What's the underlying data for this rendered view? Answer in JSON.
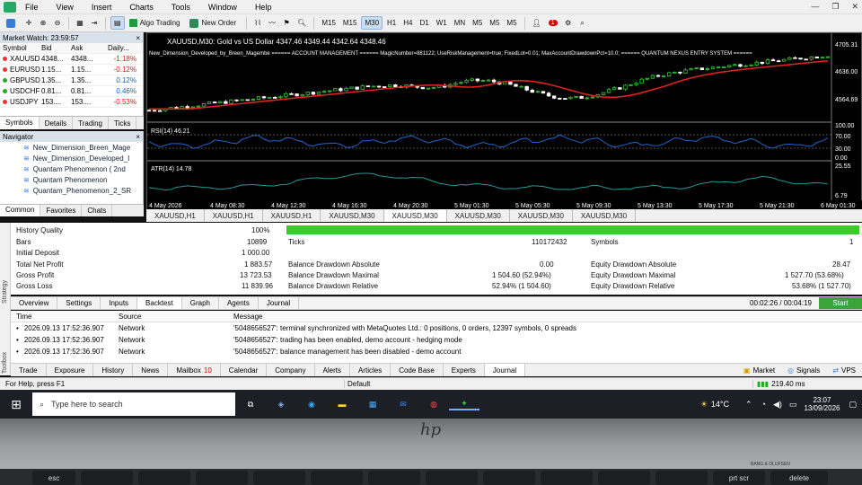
{
  "menu": {
    "items": [
      "File",
      "View",
      "Insert",
      "Charts",
      "Tools",
      "Window",
      "Help"
    ]
  },
  "toolbar": {
    "algo_trading": "Algo Trading",
    "new_order": "New Order",
    "timeframes": [
      "M1",
      "M5",
      "M15",
      "M30",
      "H1",
      "H4",
      "D1",
      "W1",
      "MN"
    ],
    "active_tf": "M30",
    "second_tf": [
      "M5",
      "M5",
      "M5"
    ],
    "notification_count": "1"
  },
  "market_watch": {
    "title": "Market Watch: 23:59:57",
    "headers": [
      "Symbol",
      "Bid",
      "Ask",
      "Daily..."
    ],
    "rows": [
      {
        "symbol": "XAUUSD",
        "bid": "4348...",
        "ask": "4348...",
        "change": "-1.18%",
        "dir": "neg"
      },
      {
        "symbol": "EURUSD",
        "bid": "1.15...",
        "ask": "1.15...",
        "change": "-0.12%",
        "dir": "neg"
      },
      {
        "symbol": "GBPUSD",
        "bid": "1.35...",
        "ask": "1.35...",
        "change": "0.12%",
        "dir": "pos"
      },
      {
        "symbol": "USDCHF",
        "bid": "0.81...",
        "ask": "0.81...",
        "change": "0.46%",
        "dir": "pos"
      },
      {
        "symbol": "USDJPY",
        "bid": "153....",
        "ask": "153....",
        "change": "-0.53%",
        "dir": "neg"
      }
    ],
    "tabs": [
      "Symbols",
      "Details",
      "Trading",
      "Ticks"
    ]
  },
  "navigator": {
    "title": "Navigator",
    "items": [
      "New_Dimension_Breen_Mage",
      "New_Dimension_Developed_I",
      "Quantam Phenomenon ( 2nd",
      "Quantam Phenomenon",
      "Quantam_Phenomenon_2_SR"
    ],
    "tabs": [
      "Common",
      "Favorites",
      "Chats"
    ]
  },
  "chart": {
    "title": "XAUUSD,M30:  Gold vs US Dollar  4347.46 4349.44 4342.64 4348.46",
    "ea_text": "New_Dimension_Developed_by_Breen_Magembe ====== ACCOUNT MANAGEMENT ====== MagicNumber=881122; UseRiskManagement=true; FixedLot=0.01; MaxAccountDrawdownPct=10.0; ====== QUANTUM NEXUS ENTRY SYSTEM ======",
    "price_labels": [
      "4705.31",
      "4636.00",
      "4564.69"
    ],
    "rsi_label": "RSI(14) 46.21",
    "rsi_levels": [
      "100.00",
      "70.00",
      "30.00",
      "0.00"
    ],
    "atr_label": "ATR(14) 14.78",
    "atr_levels": [
      "25.55",
      "6.79"
    ],
    "time_labels": [
      "4 May 2026",
      "4 May 08:30",
      "4 May 12:30",
      "4 May 16:30",
      "4 May 20:30",
      "5 May 01:30",
      "5 May 05:30",
      "5 May 09:30",
      "5 May 13:30",
      "5 May 17:30",
      "5 May 21:30",
      "6 May 01:30"
    ],
    "tabs": [
      "XAUUSD,H1",
      "XAUUSD,H1",
      "XAUUSD,H1",
      "XAUUSD,M30",
      "XAUUSD,M30",
      "XAUUSD,M30",
      "XAUUSD,M30",
      "XAUUSD,M30"
    ],
    "colors": {
      "bull": "#33cc33",
      "bear": "#ffffff",
      "ma_fast": "#dd2222",
      "indicator": "#2266cc",
      "atr": "#229999"
    }
  },
  "tester": {
    "history_quality_label": "History Quality",
    "history_quality": "100%",
    "quality_fill": 1.0,
    "bars_label": "Bars",
    "bars": "10899",
    "ticks_label": "Ticks",
    "ticks": "110172432",
    "symbols_label": "Symbols",
    "symbols": "1",
    "initial_deposit_label": "Initial Deposit",
    "initial_deposit": "1 000.00",
    "net_profit_label": "Total Net Profit",
    "net_profit": "1 883.57",
    "bal_dd_abs_label": "Balance Drawdown Absolute",
    "bal_dd_abs": "0.00",
    "eq_dd_abs_label": "Equity Drawdown Absolute",
    "eq_dd_abs": "28.47",
    "gross_profit_label": "Gross Profit",
    "gross_profit": "13 723.53",
    "bal_dd_max_label": "Balance Drawdown Maximal",
    "bal_dd_max": "1 504.60 (52.94%)",
    "eq_dd_max_label": "Equity Drawdown Maximal",
    "eq_dd_max": "1 527.70 (53.68%)",
    "gross_loss_label": "Gross Loss",
    "gross_loss": "11 839.96",
    "bal_dd_rel_label": "Balance Drawdown Relative",
    "bal_dd_rel": "52.94% (1 504.60)",
    "eq_dd_rel_label": "Equity Drawdown Relative",
    "eq_dd_rel": "53.68% (1 527.70)",
    "tabs": [
      "Overview",
      "Settings",
      "Inputs",
      "Backtest",
      "Graph",
      "Agents",
      "Journal"
    ],
    "active_tab": "Backtest",
    "timer": "00:02:26 / 00:04:19",
    "start_label": "Start"
  },
  "journal": {
    "headers": [
      "Time",
      "Source",
      "Message"
    ],
    "rows": [
      {
        "time": "2026.09.13 17:52:36.907",
        "source": "Network",
        "message": "'5048656527': terminal synchronized with MetaQuotes Ltd.: 0 positions, 0 orders, 12397 symbols, 0 spreads"
      },
      {
        "time": "2026.09.13 17:52:36.907",
        "source": "Network",
        "message": "'5048656527': trading has been enabled, demo account - hedging mode"
      },
      {
        "time": "2026.09.13 17:52:36.907",
        "source": "Network",
        "message": "'5048656527': balance management has been disabled - demo account"
      }
    ]
  },
  "toolbox": {
    "tabs": [
      "Trade",
      "Exposure",
      "History",
      "News",
      "Mailbox",
      "Calendar",
      "Company",
      "Alerts",
      "Articles",
      "Code Base",
      "Experts",
      "Journal"
    ],
    "mailbox_count": "10",
    "right": [
      "Market",
      "Signals",
      "VPS"
    ]
  },
  "sidebar": {
    "strategy": "Strategy",
    "toolbox": "Toolbox"
  },
  "status": {
    "help": "For Help, press F1",
    "profile": "Default",
    "ping": "219.40 ms"
  },
  "taskbar": {
    "search_placeholder": "Type here to search",
    "temp": "14°C",
    "time": "23:07",
    "date": "13/09/2026"
  },
  "laptop": {
    "brand": "hp",
    "keys": [
      "esc",
      "prt scr",
      "delete"
    ],
    "speaker": "BANG & OLUFSEN"
  }
}
